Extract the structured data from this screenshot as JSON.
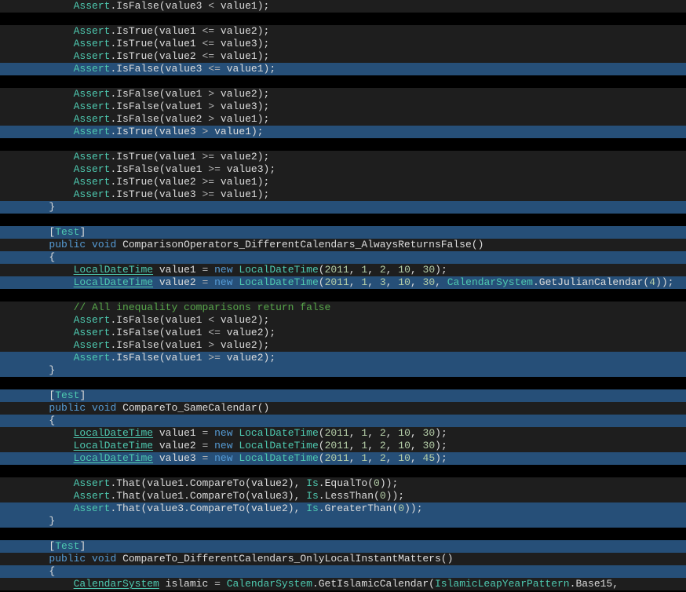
{
  "tokens": {
    "Assert": "Assert",
    "IsFalse": "IsFalse",
    "IsTrue": "IsTrue",
    "That": "That",
    "LocalDateTime": "LocalDateTime",
    "CalendarSystem": "CalendarSystem",
    "GetJulianCalendar": "GetJulianCalendar",
    "GetIslamicCalendar": "GetIslamicCalendar",
    "IslamicLeapYearPattern": "IslamicLeapYearPattern",
    "Base15": "Base15",
    "Is": "Is",
    "EqualTo": "EqualTo",
    "LessThan": "LessThan",
    "GreaterThan": "GreaterThan",
    "CompareTo": "CompareTo",
    "value1": "value1",
    "value2": "value2",
    "value3": "value3",
    "islamic": "islamic",
    "new": "new",
    "public": "public",
    "void": "void",
    "Test": "Test",
    "comment1": "// All inequality comparisons return false",
    "method1": "ComparisonOperators_DifferentCalendars_AlwaysReturnsFalse",
    "method2": "CompareTo_SameCalendar",
    "method3": "CompareTo_DifferentCalendars_OnlyLocalInstantMatters",
    "eq": "=",
    "lt": "<",
    "gt": ">",
    "lte": "<=",
    "gte": ">=",
    "n0": "0",
    "n1": "1",
    "n2": "2",
    "n3": "3",
    "n4": "4",
    "n10": "10",
    "n30": "30",
    "n45": "45",
    "n2011": "2011",
    "lbrace": "{",
    "rbrace": "}",
    "lbrack": "[",
    "rbrack": "]",
    "lp": "(",
    "rp": ")",
    "semi": ";",
    "comma": ",",
    "dot": "."
  }
}
